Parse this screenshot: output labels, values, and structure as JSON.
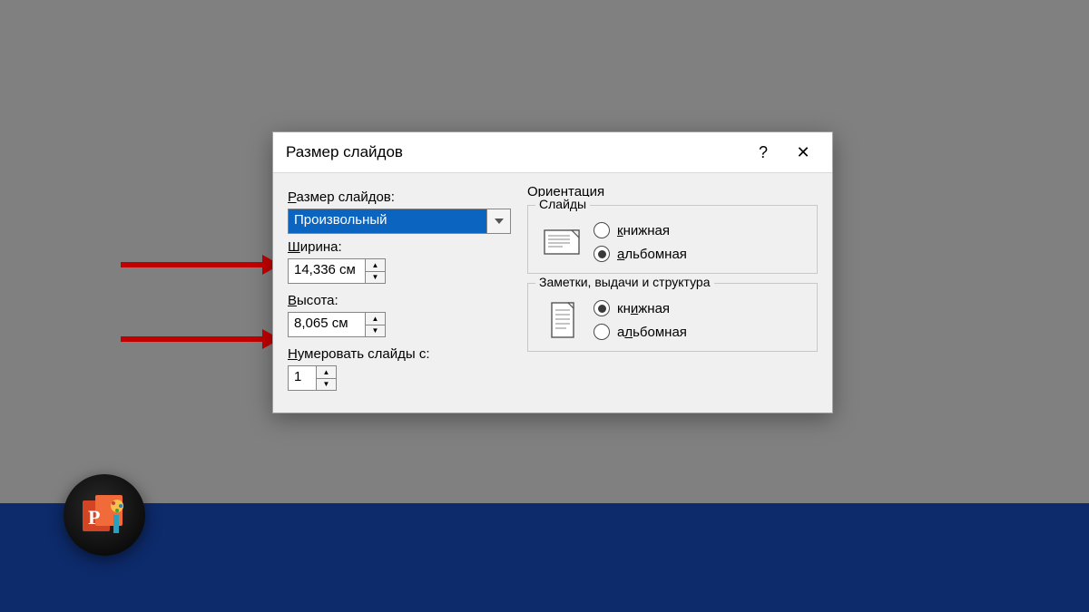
{
  "dialog": {
    "title": "Размер слайдов",
    "help_glyph": "?",
    "close_glyph": "✕",
    "size_label_pre": "Р",
    "size_label_rest": "азмер слайдов:",
    "size_selected": "Произвольный",
    "width_label_pre": "Ш",
    "width_label_rest": "ирина:",
    "width_value": "14,336 см",
    "height_label_pre": "В",
    "height_label_rest": "ысота:",
    "height_value": "8,065 см",
    "numbering_label_pre": "Н",
    "numbering_label_rest": "умеровать слайды с:",
    "numbering_value": "1"
  },
  "orientation": {
    "heading": "Ориентация",
    "slides": {
      "legend": "Слайды",
      "portrait_u": "к",
      "portrait_rest": "нижная",
      "landscape_u": "а",
      "landscape_rest": "льбомная",
      "selected": "landscape"
    },
    "notes": {
      "legend": "Заметки, выдачи и структура",
      "portrait_pre": "кн",
      "portrait_u": "и",
      "portrait_rest": "жная",
      "landscape_pre": "а",
      "landscape_u": "л",
      "landscape_rest": "ьбомная",
      "selected": "portrait"
    }
  }
}
